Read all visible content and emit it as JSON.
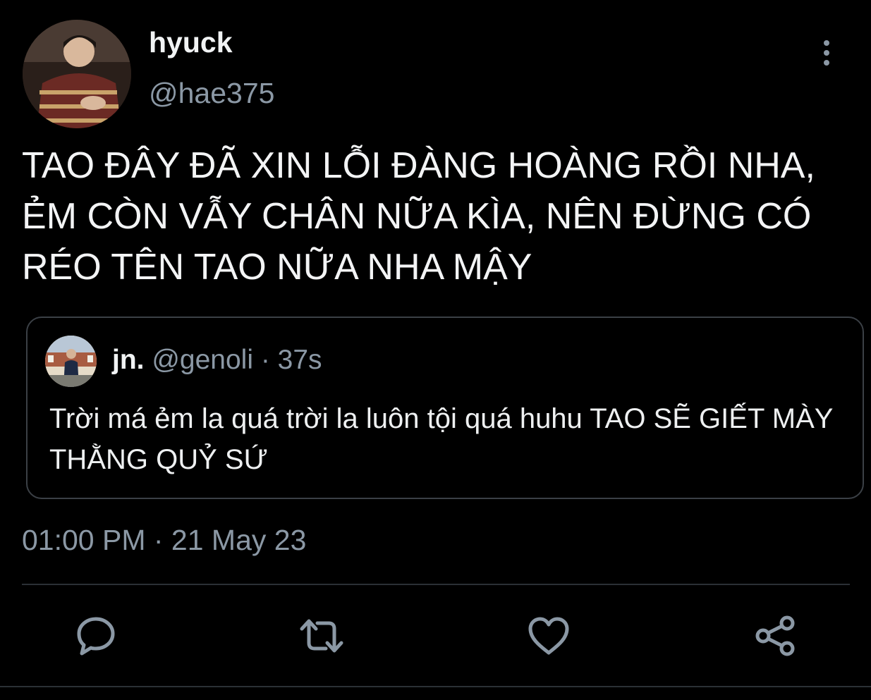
{
  "tweet": {
    "author": {
      "display_name": "hyuck",
      "handle": "@hae375"
    },
    "text": "TAO ĐÂY ĐÃ XIN LỖI ĐÀNG HOÀNG RỒI NHA, ẺM CÒN VẪY CHÂN NỮA KÌA, NÊN ĐỪNG CÓ RÉO TÊN TAO NỮA NHA MẬY",
    "quoted": {
      "display_name": "jn.",
      "meta": " @genoli · 37s",
      "text": "Trời má ẻm la quá trời la luôn tội quá huhu TAO SẼ GIẾT MÀY THẰNG QUỶ SỨ"
    },
    "timestamp": "01:00 PM · 21 May 23"
  },
  "icons": {
    "more": "more-vertical-icon",
    "reply": "reply-icon",
    "retweet": "retweet-icon",
    "like": "heart-icon",
    "share": "share-icon"
  },
  "colors": {
    "background": "#000000",
    "text": "#e7e9ea",
    "secondary": "#8b98a5",
    "border": "#3b4046"
  }
}
